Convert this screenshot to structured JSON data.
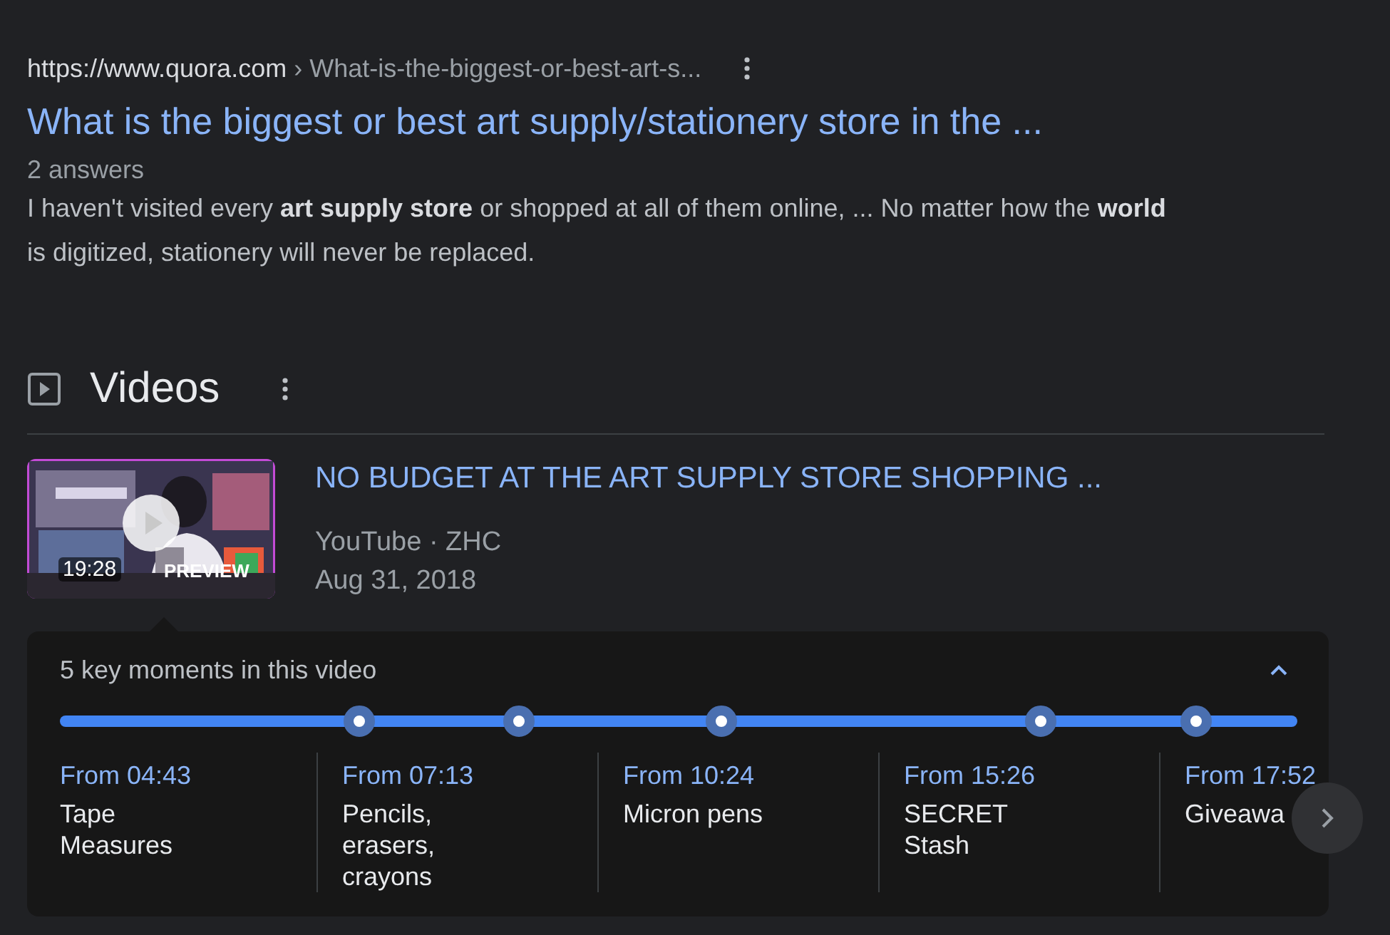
{
  "result": {
    "url": "https://www.quora.com",
    "breadcrumb": "› What-is-the-biggest-or-best-art-s...",
    "title": "What is the biggest or best art supply/stationery store in the ...",
    "meta": "2 answers",
    "snippet": "I haven't visited every **art supply store** or shopped at all of them online, ... No matter how the **world** is digitized, stationery will never be replaced."
  },
  "videos_section": {
    "heading": "Videos",
    "video": {
      "duration": "19:28",
      "preview_label": "PREVIEW",
      "title": "NO BUDGET AT THE ART SUPPLY STORE SHOPPING ...",
      "source": "YouTube · ZHC",
      "date": "Aug 31, 2018"
    },
    "key_moments": {
      "heading": "5 key moments in this video",
      "expanded": true,
      "moments": [
        {
          "time": "From 04:43",
          "label": "Tape Measures"
        },
        {
          "time": "From 07:13",
          "label": "Pencils, erasers, crayons"
        },
        {
          "time": "From 10:24",
          "label": "Micron pens"
        },
        {
          "time": "From 15:26",
          "label": "SECRET Stash"
        },
        {
          "time": "From 17:52",
          "label": "Giveawa"
        }
      ]
    }
  }
}
